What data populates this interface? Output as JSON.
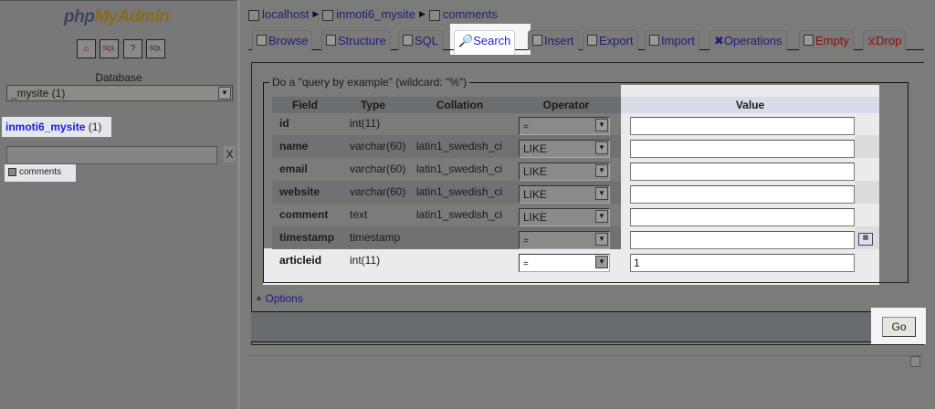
{
  "sidebar": {
    "logo": {
      "php": "php",
      "myadmin": "MyAdmin"
    },
    "quick_icons": [
      "home-icon",
      "sql-query-icon",
      "help-icon",
      "docs-icon"
    ],
    "database_label": "Database",
    "database_select": "_mysite (1)",
    "db_link": "inmoti6_mysite",
    "db_count": "(1)",
    "filter_value": "",
    "filter_clear": "X",
    "tables": [
      "comments"
    ]
  },
  "breadcrumb": [
    "localhost",
    "inmoti6_mysite",
    "comments"
  ],
  "tabs": [
    {
      "label": "Browse",
      "active": false
    },
    {
      "label": "Structure",
      "active": false
    },
    {
      "label": "SQL",
      "active": false
    },
    {
      "label": "Search",
      "active": true
    },
    {
      "label": "Insert",
      "active": false
    },
    {
      "label": "Export",
      "active": false
    },
    {
      "label": "Import",
      "active": false
    },
    {
      "label": "Operations",
      "active": false
    },
    {
      "label": "Empty",
      "active": false
    },
    {
      "label": "Drop",
      "active": false
    }
  ],
  "form": {
    "legend": "Do a \"query by example\" (wildcard: \"%\")",
    "headers": [
      "Field",
      "Type",
      "Collation",
      "Operator",
      "Value"
    ],
    "rows": [
      {
        "field": "id",
        "type": "int(11)",
        "collation": "",
        "operator": "=",
        "value": ""
      },
      {
        "field": "name",
        "type": "varchar(60)",
        "collation": "latin1_swedish_ci",
        "operator": "LIKE",
        "value": ""
      },
      {
        "field": "email",
        "type": "varchar(60)",
        "collation": "latin1_swedish_ci",
        "operator": "LIKE",
        "value": ""
      },
      {
        "field": "website",
        "type": "varchar(60)",
        "collation": "latin1_swedish_ci",
        "operator": "LIKE",
        "value": ""
      },
      {
        "field": "comment",
        "type": "text",
        "collation": "latin1_swedish_ci",
        "operator": "LIKE",
        "value": ""
      },
      {
        "field": "timestamp",
        "type": "timestamp",
        "collation": "",
        "operator": "=",
        "value": ""
      },
      {
        "field": "articleid",
        "type": "int(11)",
        "collation": "",
        "operator": "=",
        "value": "1"
      }
    ],
    "options_plus": "+",
    "options_label": "Options",
    "go_label": "Go"
  }
}
